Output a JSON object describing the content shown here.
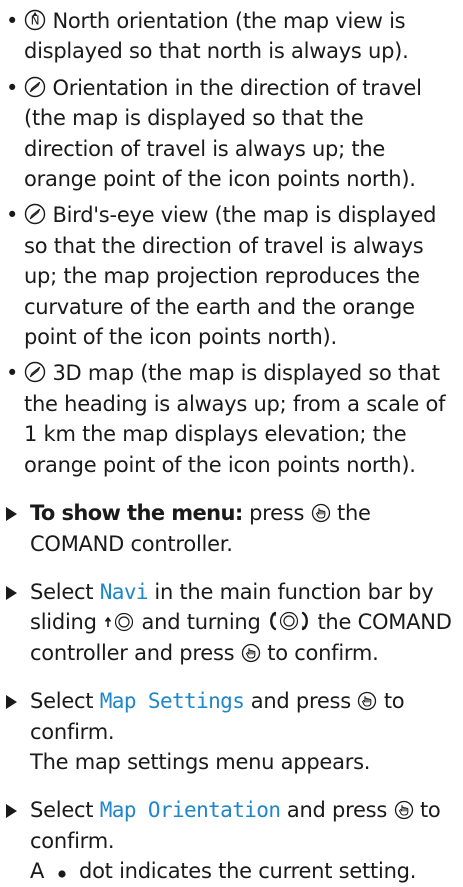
{
  "bullets": [
    {
      "icon": "north-orientation-icon",
      "text": "North orientation (the map view is displayed so that north is always up)."
    },
    {
      "icon": "compass-heading-icon",
      "text": "Orientation in the direction of travel (the map is displayed so that the direction of travel is always up; the orange point of the icon points north)."
    },
    {
      "icon": "compass-heading-icon",
      "text": "Bird's-eye view (the map is displayed so that the direction of travel is always up; the map projection reproduces the curvature of the earth and the orange point of the icon points north)."
    },
    {
      "icon": "compass-heading-icon",
      "text": "3D map (the map is displayed so that the heading is always up; from a scale of 1 km the map displays elevation; the orange point of the icon points north)."
    }
  ],
  "steps": {
    "show_menu": {
      "bold": "To show the menu:",
      "pre": "press",
      "post": "the COMAND controller."
    },
    "select_navi": {
      "a": "Select",
      "kw": "Navi",
      "b": "in the main function bar by sliding",
      "c": "and turning",
      "d": "the COMAND controller and press",
      "e": "to confirm."
    },
    "map_settings": {
      "a": "Select",
      "kw": "Map Settings",
      "b": "and press",
      "c": "to confirm.",
      "result": "The map settings menu appears."
    },
    "map_orientation": {
      "a": "Select",
      "kw": "Map Orientation",
      "b": "and press",
      "c": "to confirm.",
      "result_a": "A",
      "result_b": "dot indicates the current setting."
    }
  },
  "colors": {
    "text": "#1a1a1a",
    "keyword": "#1f86c9"
  }
}
